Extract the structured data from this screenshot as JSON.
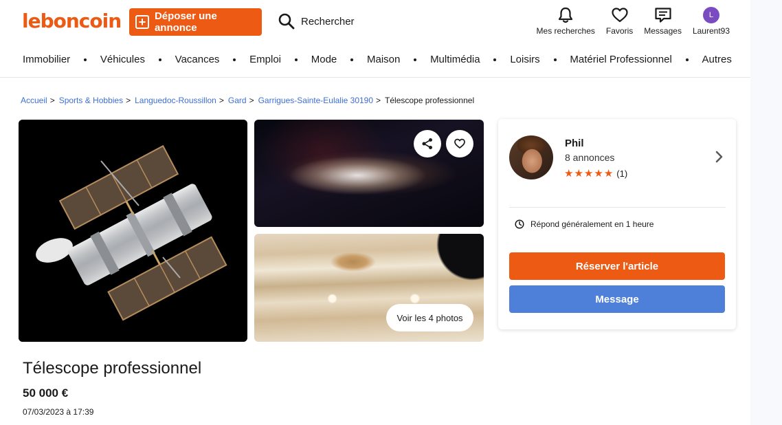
{
  "header": {
    "logo": "leboncoin",
    "post_ad_label": "Déposer une annonce",
    "search_label": "Rechercher",
    "nav": [
      {
        "label": "Mes recherches",
        "icon": "bell-icon"
      },
      {
        "label": "Favoris",
        "icon": "heart-icon"
      },
      {
        "label": "Messages",
        "icon": "message-icon"
      },
      {
        "label": "Laurent93",
        "icon": "avatar",
        "initial": "L"
      }
    ]
  },
  "categories": [
    "Immobilier",
    "Véhicules",
    "Vacances",
    "Emploi",
    "Mode",
    "Maison",
    "Multimédia",
    "Loisirs",
    "Matériel Professionnel",
    "Autres"
  ],
  "breadcrumb": {
    "links": [
      "Accueil",
      "Sports & Hobbies",
      "Languedoc-Roussillon",
      "Gard",
      "Garrigues-Sainte-Eulalie 30190"
    ],
    "current": "Télescope professionnel"
  },
  "gallery": {
    "see_photos_label": "Voir les 4 photos"
  },
  "seller": {
    "name": "Phil",
    "ads_count": "8 annonces",
    "stars": 5,
    "rating_count": "(1)",
    "response_time": "Répond généralement en 1 heure",
    "reserve_label": "Réserver l'article",
    "message_label": "Message"
  },
  "listing": {
    "title": "Télescope professionnel",
    "price": "50 000 €",
    "date": "07/03/2023 à 17:39"
  },
  "colors": {
    "brand_orange": "#ec5a13",
    "message_blue": "#4f80d9",
    "link_blue": "#3e6fd3"
  }
}
